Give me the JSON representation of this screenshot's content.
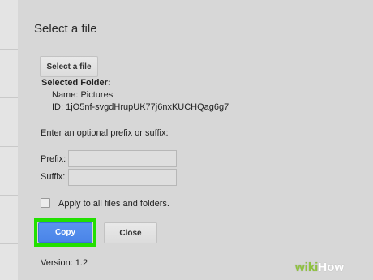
{
  "dialog": {
    "title": "Select a file",
    "select_file_button": "Select a file",
    "selected_folder": {
      "heading": "Selected Folder:",
      "name": "Name: Pictures",
      "id": "ID: 1jO5nf-svgdHrupUK77j6nxKUCHQag6g7"
    },
    "prefix_suffix_hint": "Enter an optional prefix or suffix:",
    "prefix": {
      "label": "Prefix:",
      "value": ""
    },
    "suffix": {
      "label": "Suffix:",
      "value": ""
    },
    "apply_all": {
      "label": "Apply to all files and folders.",
      "checked": false
    },
    "copy_button": "Copy",
    "close_button": "Close",
    "version": "Version: 1.2"
  },
  "watermark": {
    "wiki": "wiki",
    "how": "How"
  },
  "colors": {
    "copy_button": "#4a84e8",
    "highlight": "#22e000",
    "background": "#d7d7d7"
  }
}
